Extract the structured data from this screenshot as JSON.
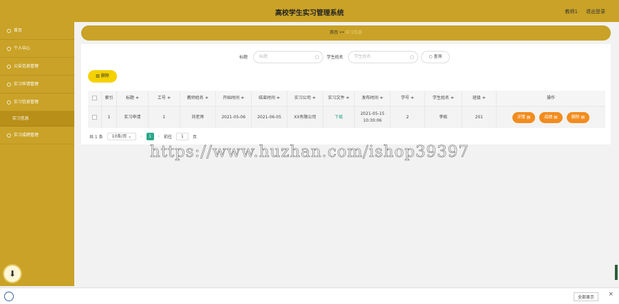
{
  "header": {
    "title": "高校学生实习管理系统",
    "user": "教师1",
    "logout": "退出登录"
  },
  "sidebar": {
    "items": [
      {
        "label": "首页"
      },
      {
        "label": "个人中心"
      },
      {
        "label": "公告信息管理"
      },
      {
        "label": "实习申请管理"
      },
      {
        "label": "实习信息管理"
      },
      {
        "label": "实习信息",
        "sub": true
      },
      {
        "label": "实习成绩管理"
      }
    ]
  },
  "breadcrumb": {
    "home": "首页",
    "sep": "••",
    "current": "实习信息"
  },
  "search": {
    "title_label": "标题",
    "title_placeholder": "标题",
    "student_label": "学生姓名",
    "student_placeholder": "学生姓名",
    "query_label": "查询"
  },
  "toolbar": {
    "delete_label": "删除"
  },
  "table": {
    "columns": [
      "索引",
      "标题 ≑",
      "工号 ≑",
      "教师姓名 ≑",
      "开始时间 ≑",
      "结束时间 ≑",
      "实习公司 ≑",
      "实习文件 ≑",
      "发布时间 ≑",
      "学号 ≑",
      "学生姓名 ≑",
      "班级 ≑",
      "操作"
    ],
    "rows": [
      {
        "index": "1",
        "title": "实习申请",
        "job_no": "1",
        "teacher": "刘老师",
        "start": "2021-05-06",
        "end": "2021-06-05",
        "company": "XX有限公司",
        "file": "下载",
        "publish_date": "2021-05-15",
        "publish_time": "10:30:06",
        "student_no": "2",
        "student": "李拓",
        "class": "201"
      }
    ],
    "actions": {
      "detail": "详情 ▤",
      "grade": "成绩 ▤",
      "delete": "删除 ▤"
    }
  },
  "pager": {
    "total": "共 1 条",
    "page_size": "10条/页",
    "current_page": "1",
    "goto_label": "前往",
    "goto_value": "1",
    "page_unit": "页"
  },
  "watermark": "https://www.huzhan.com/ishop39397",
  "footer": {
    "show_all": "全部显示",
    "close": "×"
  },
  "colors": {
    "brand": "#c9a227",
    "accent": "#f28c1e",
    "link": "#2aa889"
  }
}
